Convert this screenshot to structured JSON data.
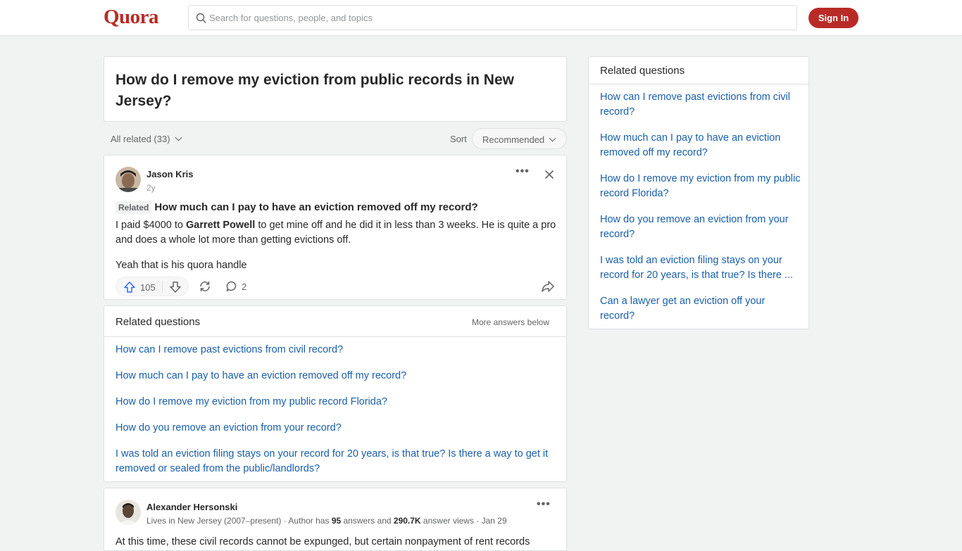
{
  "header": {
    "logo": "Quora",
    "search_placeholder": "Search for questions, people, and topics",
    "signin_label": "Sign In"
  },
  "question": {
    "title": "How do I remove my eviction from public records in New Jersey?"
  },
  "filters": {
    "all_related": "All related (33)",
    "sort_label": "Sort",
    "sort_value": "Recommended"
  },
  "answer1": {
    "author": "Jason Kris",
    "time": "2y",
    "related_badge": "Related",
    "related_question": "How much can I pay to have an eviction removed off my record?",
    "body_pre": "I paid $4000 to ",
    "body_bold": "Garrett Powell",
    "body_post": " to get mine off and he did it in less than 3 weeks. He is quite a pro and does a whole lot more than getting evictions off.",
    "body2": "Yeah that is his quora handle",
    "upvotes": "105",
    "comments": "2"
  },
  "related_inline": {
    "heading": "Related questions",
    "more_label": "More answers below",
    "items": [
      "How can I remove past evictions from civil record?",
      "How much can I pay to have an eviction removed off my record?",
      "How do I remove my eviction from my public record Florida?",
      "How do you remove an eviction from your record?",
      "I was told an eviction filing stays on your record for 20 years, is that true? Is there a way to get it removed or sealed from the public/landlords?"
    ]
  },
  "answer2": {
    "author": "Alexander Hersonski",
    "meta_pre": "Lives in New Jersey (2007–present) · Author has ",
    "answers_count": "95",
    "meta_mid": " answers and ",
    "views_count": "290.7K",
    "meta_post": " answer views · Jan 29",
    "body_preview": "At this time, these civil records cannot be expunged, but certain nonpayment of rent records"
  },
  "sidebar": {
    "heading": "Related questions",
    "items": [
      "How can I remove past evictions from civil record?",
      "How much can I pay to have an eviction removed off my record?",
      "How do I remove my eviction from my public record Florida?",
      "How do you remove an eviction from your record?",
      "I was told an eviction filing stays on your record for 20 years, is that true? Is there ...",
      "Can a lawyer get an eviction off your record?"
    ]
  },
  "colors": {
    "brand": "#b92b27",
    "link": "#195faa",
    "upvote": "#2e69ff"
  }
}
